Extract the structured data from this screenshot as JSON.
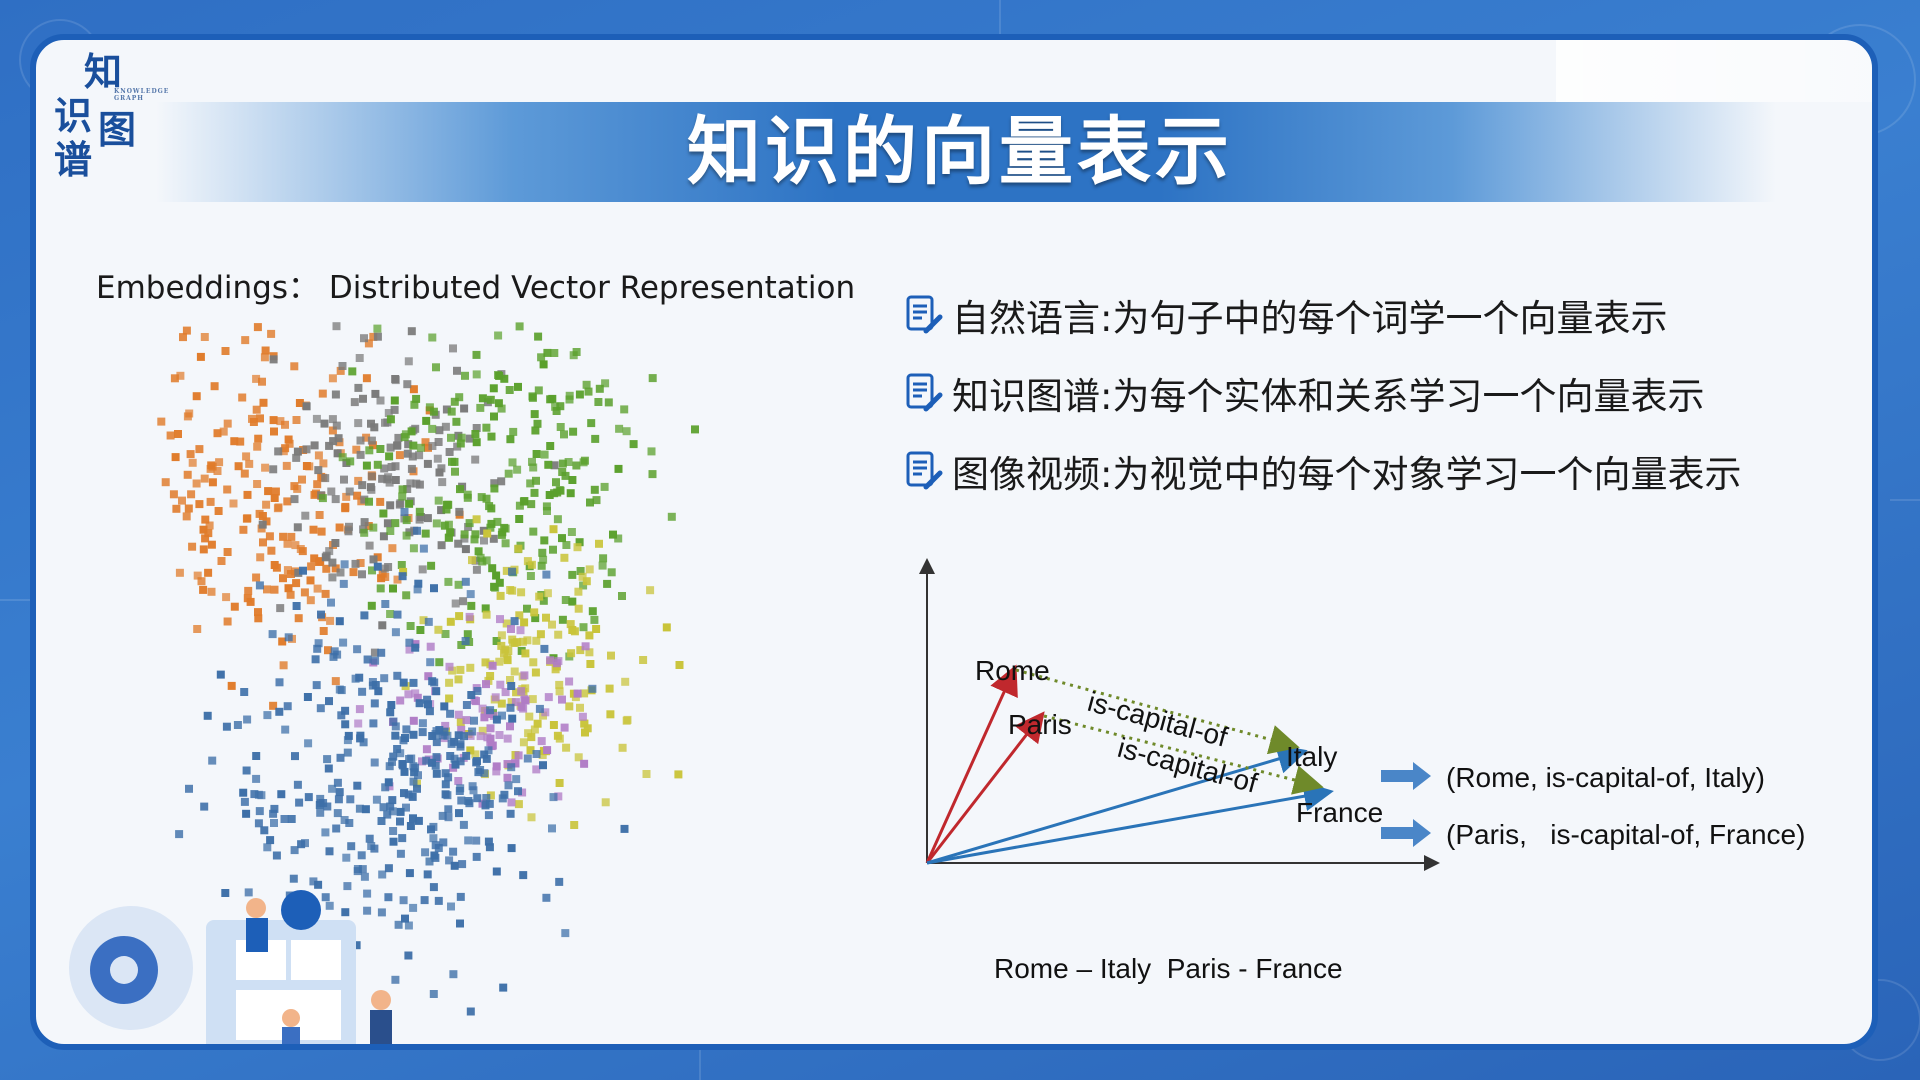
{
  "slide": {
    "title": "知识的向量表示",
    "logo": {
      "chars": [
        "知",
        "识",
        "图",
        "谱"
      ],
      "sub": "KNOWLEDGE GRAPH"
    }
  },
  "left": {
    "heading": "Embeddings：  Distributed Vector Representation"
  },
  "bullets": [
    {
      "text": "自然语言:为句子中的每个词学一个向量表示",
      "icon": "document-pen-icon"
    },
    {
      "text": "知识图谱:为每个实体和关系学习一个向量表示",
      "icon": "document-pen-icon"
    },
    {
      "text": "图像视频:为视觉中的每个对象学习一个向量表示",
      "icon": "document-pen-icon"
    }
  ],
  "diagram": {
    "labels": {
      "rome": "Rome",
      "paris": "Paris",
      "italy": "Italy",
      "france": "France",
      "rel1": "is-capital-of",
      "rel2": "is-capital-of"
    },
    "triples": [
      "(Rome, is-capital-of, Italy)",
      "(Paris,   is-capital-of, France)"
    ],
    "caption": "Rome – Italy  Paris - France"
  },
  "colors": {
    "entity_vector": "#c0282d",
    "country_vector": "#2a74b8",
    "relation_dotted": "#6f8a2a",
    "arrow": "#4a86c8",
    "cluster_orange": "#e07b2a",
    "cluster_green": "#5aa02c",
    "cluster_gray": "#7a7a7a",
    "cluster_blue": "#3d6fa8",
    "cluster_yellow": "#c9c43a",
    "cluster_purple": "#b07cc6"
  }
}
